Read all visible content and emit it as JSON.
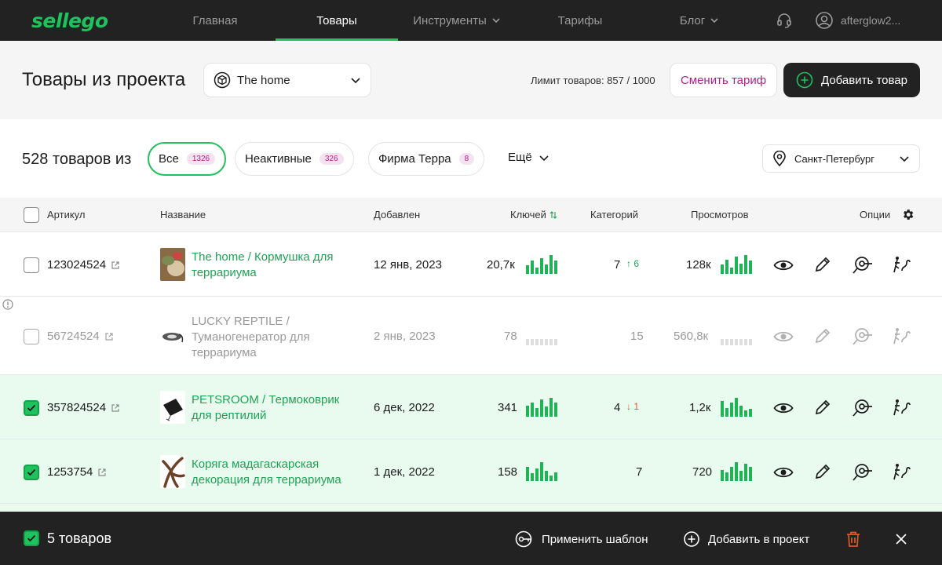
{
  "nav": {
    "logo": "sellego",
    "items": [
      {
        "label": "Главная"
      },
      {
        "label": "Товары"
      },
      {
        "label": "Инструменты"
      },
      {
        "label": "Тарифы"
      },
      {
        "label": "Блог"
      }
    ],
    "active_index": 1,
    "user": "afterglow2..."
  },
  "header": {
    "title": "Товары из проекта",
    "project": "The home",
    "limit": "Лимит товаров: 857 / 1000",
    "change_plan": "Сменить тариф",
    "add_product": "Добавить товар"
  },
  "filters": {
    "count_text": "528 товаров из",
    "chips": [
      {
        "label": "Все",
        "count": "1326"
      },
      {
        "label": "Неактивные",
        "count": "326"
      },
      {
        "label": "Фирма Терра",
        "count": "8"
      }
    ],
    "more": "Ещё",
    "city": "Санкт-Петербург"
  },
  "table": {
    "headers": {
      "article": "Артикул",
      "name": "Название",
      "added": "Добавлен",
      "keys": "Ключей",
      "categories": "Категорий",
      "views": "Просмотров",
      "options": "Опции"
    },
    "rows": [
      {
        "article": "123024524",
        "name_line1": "The home / Кормушка для",
        "name_line2": "террариума",
        "name_line3": "",
        "added": "12 янв, 2023",
        "keys": "20,7к",
        "keys_bars": [
          0.45,
          0.7,
          0.35,
          0.85,
          0.5,
          1.0,
          0.7
        ],
        "categories": "7",
        "cat_delta": "↑ 6",
        "views": "128к",
        "views_bars": [
          0.5,
          0.75,
          0.35,
          0.9,
          0.55,
          1.0,
          0.7
        ],
        "checked": false,
        "inactive": false
      },
      {
        "article": "56724524",
        "name_line1": "LUCKY REPTILE /",
        "name_line2": "Туманогенератор для",
        "name_line3": "террариума",
        "added": "2 янв, 2023",
        "keys": "78",
        "keys_bars": [
          0.35,
          0.35,
          0.35,
          0.35,
          0.35,
          0.35,
          0.35
        ],
        "categories": "15",
        "cat_delta": "",
        "views": "560,8к",
        "views_bars": [
          0.35,
          0.35,
          0.35,
          0.35,
          0.35,
          0.35,
          0.35
        ],
        "checked": false,
        "inactive": true
      },
      {
        "article": "357824524",
        "name_line1": "PETSROOM / Термоковрик",
        "name_line2": "для рептилий",
        "name_line3": "",
        "added": "6 дек, 2022",
        "keys": "341",
        "keys_bars": [
          0.6,
          0.75,
          0.45,
          0.9,
          0.55,
          1.0,
          0.75
        ],
        "categories": "4",
        "cat_delta": "↓ 1",
        "views": "1,2к",
        "views_bars": [
          0.85,
          0.45,
          0.75,
          1.0,
          0.6,
          0.35,
          0.4
        ],
        "checked": true,
        "inactive": false
      },
      {
        "article": "1253754",
        "name_line1": "Коряга мадагаскарская",
        "name_line2": "декорация для террариума",
        "name_line3": "",
        "added": "1 дек, 2022",
        "keys": "158",
        "keys_bars": [
          0.75,
          0.4,
          0.65,
          1.0,
          0.55,
          0.3,
          0.45
        ],
        "categories": "7",
        "cat_delta": "",
        "views": "720",
        "views_bars": [
          0.6,
          0.45,
          0.75,
          1.0,
          0.55,
          0.9,
          0.75
        ],
        "checked": true,
        "inactive": false
      }
    ]
  },
  "bottom": {
    "selected": "5 товаров",
    "apply_template": "Применить шаблон",
    "add_to_project": "Добавить в проект"
  },
  "colors": {
    "accent": "#1fc25c",
    "brand_purple": "#b0208a",
    "dark": "#222222",
    "selected_row": "#e9fbef",
    "danger": "#e0572a"
  },
  "icons": [
    "headset-icon",
    "user-icon",
    "cube-icon",
    "chevron-down-icon",
    "plus-circle-icon",
    "location-pin-icon",
    "gear-icon",
    "external-link-icon",
    "eye-icon",
    "pencil-icon",
    "target-search-icon",
    "route-icon",
    "warning-icon",
    "template-icon",
    "trash-icon",
    "close-icon",
    "sort-icon",
    "check-icon"
  ]
}
